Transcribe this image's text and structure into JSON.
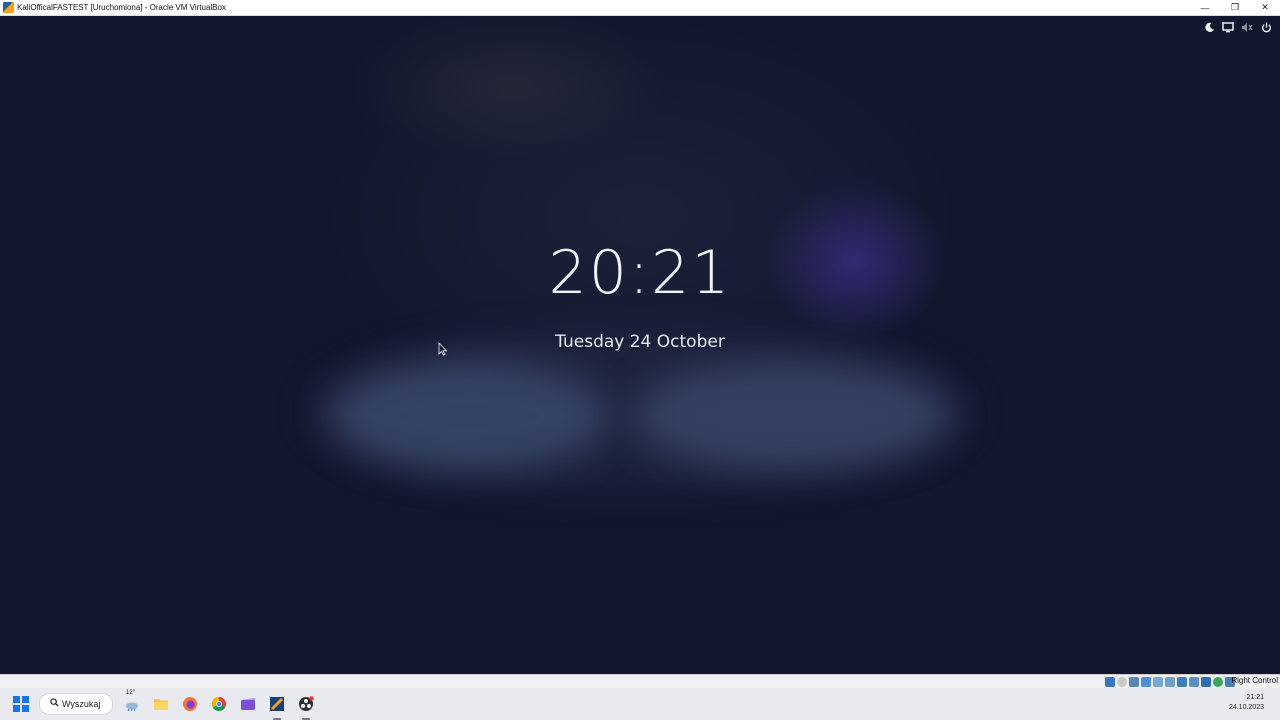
{
  "window": {
    "title": "KaliOfficalFASTEST [Uruchomiona] - Oracle VM VirtualBox",
    "minimize_glyph": "—",
    "restore_glyph": "❐",
    "close_glyph": "✕"
  },
  "lock_screen": {
    "time": "20:21",
    "date": "Tuesday 24 October",
    "status_icons": [
      "night-mode-icon",
      "display-icon",
      "sound-muted-icon",
      "power-icon"
    ]
  },
  "vbox_statusbar": {
    "host_key_label": "Right Control",
    "icons": [
      "hard-disk-icon",
      "optical-drive-icon",
      "audio-icon",
      "network-icon",
      "usb-icon",
      "shared-folders-icon",
      "display-icon",
      "recording-icon",
      "cpu-icon",
      "mouse-integration-icon",
      "keyboard-icon"
    ]
  },
  "taskbar": {
    "search_label": "Wyszukaj",
    "weather_temp": "12°",
    "apps": [
      "weather-widget-icon",
      "file-explorer-icon",
      "firefox-icon",
      "chrome-icon",
      "video-editor-icon",
      "virtualbox-icon",
      "obs-icon"
    ],
    "tray_time": "21:21",
    "tray_date": "24.10.2023"
  },
  "colors": {
    "lock_bg": "#13172e",
    "text": "#f2f4fa",
    "accent_blue": "#1a73e8",
    "glow_purple": "#4836aa"
  }
}
